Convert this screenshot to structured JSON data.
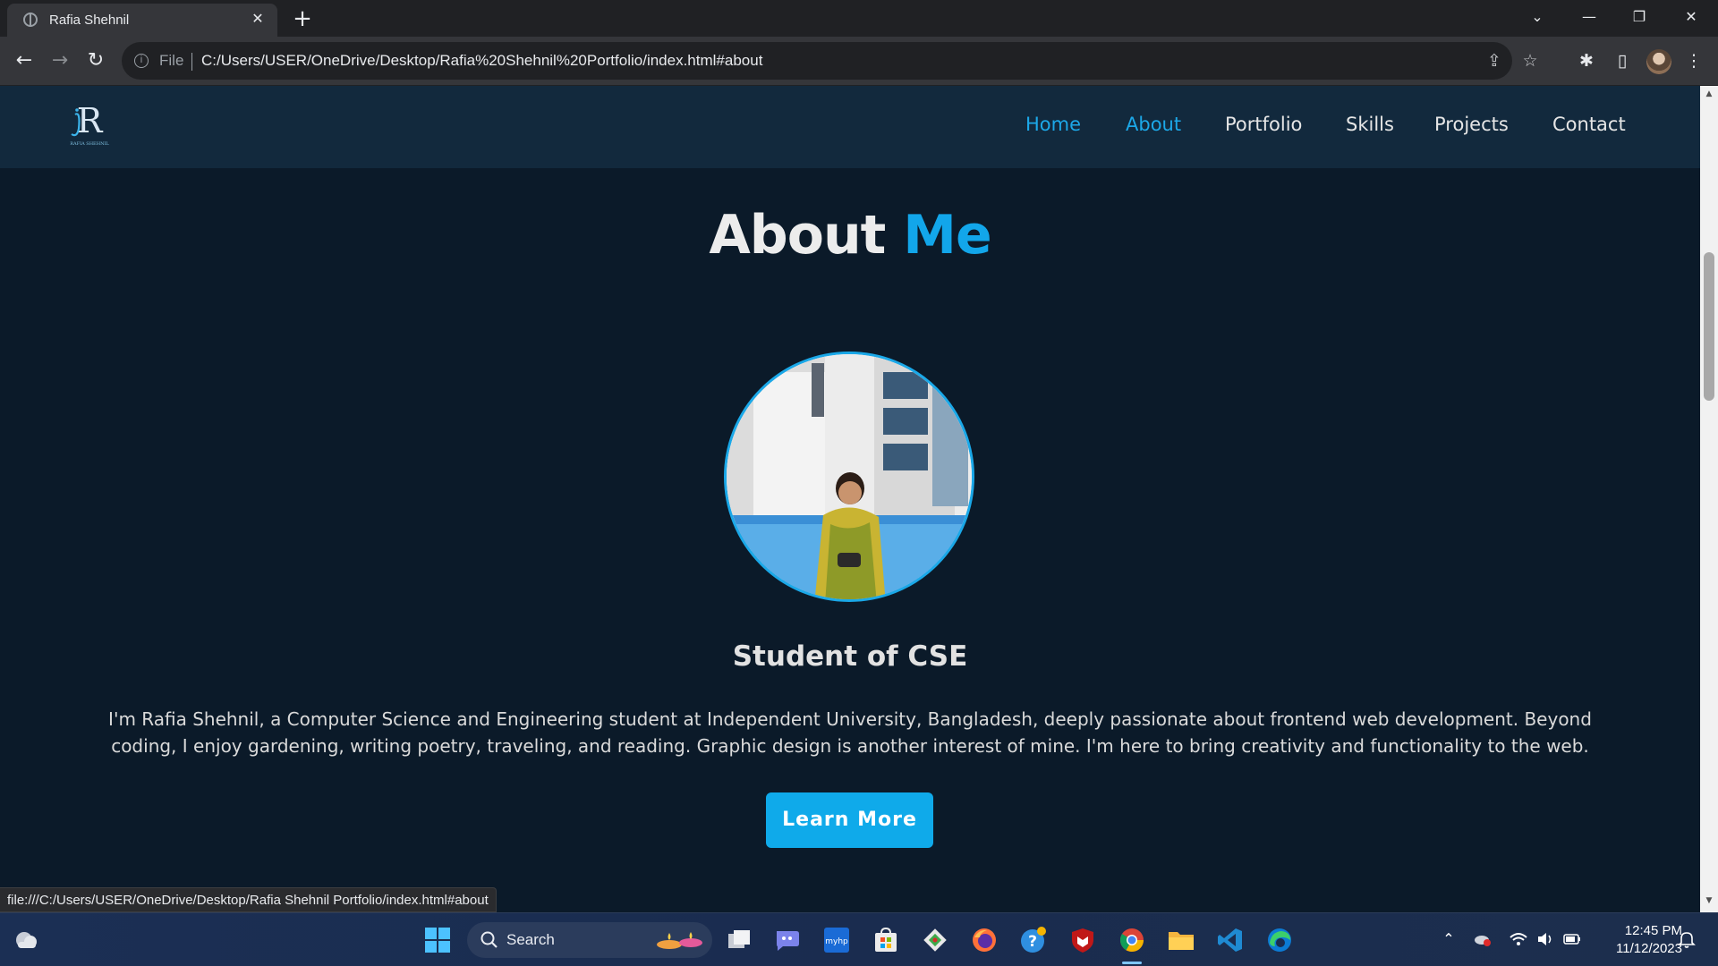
{
  "browser": {
    "tab_title": "Rafia Shehnil",
    "scheme_label": "File",
    "url": "C:/Users/USER/OneDrive/Desktop/Rafia%20Shehnil%20Portfolio/index.html#about",
    "status_url": "file:///C:/Users/USER/OneDrive/Desktop/Rafia Shehnil Portfolio/index.html#about"
  },
  "site": {
    "logo_text": "RAFIA SHEHNIL",
    "nav": [
      {
        "label": "Home"
      },
      {
        "label": "About"
      },
      {
        "label": "Portfolio"
      },
      {
        "label": "Skills"
      },
      {
        "label": "Projects"
      },
      {
        "label": "Contact"
      }
    ],
    "about": {
      "title_word1": "About",
      "title_word2": "Me",
      "subtitle": "Student of CSE",
      "bio": "I'm Rafia Shehnil, a Computer Science and Engineering student at Independent University, Bangladesh, deeply passionate about frontend web development. Beyond coding, I enjoy gardening, writing poetry, traveling, and reading. Graphic design is another interest of mine. I'm here to bring creativity and functionality to the web.",
      "button_label": "Learn More"
    }
  },
  "taskbar": {
    "search_label": "Search",
    "time": "12:45 PM",
    "date": "11/12/2023"
  },
  "colors": {
    "accent": "#12a6ea",
    "page_bg": "#0b1a29",
    "header_bg": "#12293d"
  }
}
